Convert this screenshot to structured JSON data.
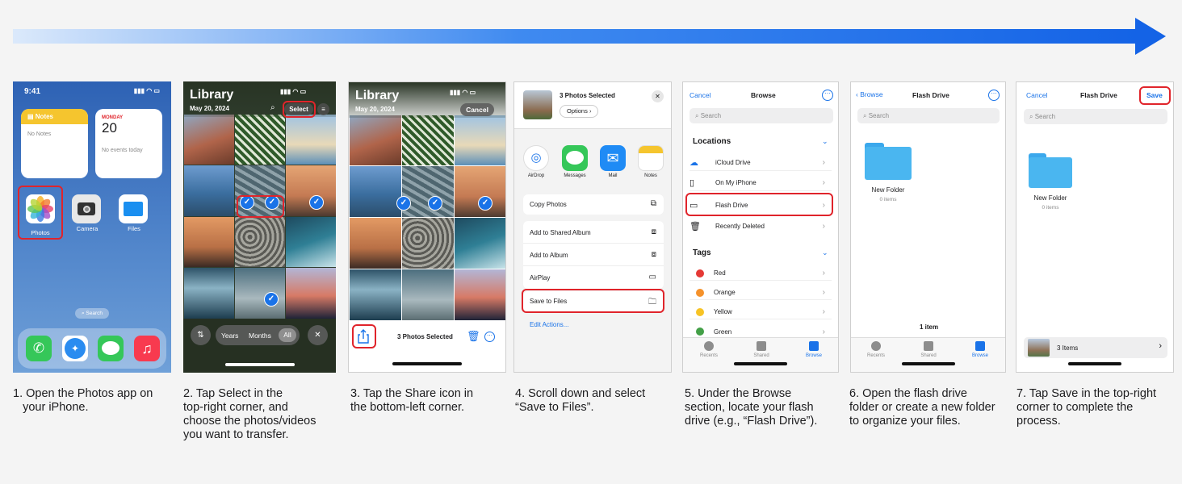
{
  "captions": [
    "1. Open the Photos app on\n   your iPhone.",
    "2. Tap Select in the\ntop-right corner, and\nchoose the photos/videos\nyou want to transfer.",
    "3. Tap the Share icon in\nthe bottom-left corner.",
    "4. Scroll down and select\n“Save to Files”.",
    "5. Under the Browse\nsection, locate your flash\ndrive (e.g., “Flash Drive”).",
    "6. Open the flash drive\nfolder or create a new folder\nto organize your files.",
    "7. Tap Save in the top-right\ncorner to complete the\nprocess."
  ],
  "colors": {
    "accent": "#1a73e8",
    "highlight": "#e0242b"
  },
  "s1": {
    "time": "9:41",
    "notes_title": "Notes",
    "notes_body": "No Notes",
    "cal_day": "MONDAY",
    "cal_date": "20",
    "cal_body": "No events today",
    "apps": [
      "Photos",
      "Camera",
      "Files"
    ],
    "search": "Search"
  },
  "s2": {
    "title": "Library",
    "date": "May 20, 2024",
    "select": "Select",
    "seg": [
      "Years",
      "Months",
      "All"
    ]
  },
  "s3": {
    "title": "Library",
    "date": "May 20, 2024",
    "cancel": "Cancel",
    "selected": "3 Photos Selected"
  },
  "s4": {
    "header": "3 Photos Selected",
    "options": "Options",
    "apps": [
      "AirDrop",
      "Messages",
      "Mail",
      "Notes"
    ],
    "actions": [
      "Copy Photos",
      "Add to Shared Album",
      "Add to Album",
      "AirPlay",
      "Save to Files"
    ],
    "edit": "Edit Actions..."
  },
  "s5": {
    "cancel": "Cancel",
    "title": "Browse",
    "search": "Search",
    "locations": "Locations",
    "locs": [
      "iCloud Drive",
      "On My iPhone",
      "Flash Drive",
      "Recently Deleted"
    ],
    "tags": "Tags",
    "tag_list": [
      "Red",
      "Orange",
      "Yellow",
      "Green"
    ],
    "tabs": [
      "Recents",
      "Shared",
      "Browse"
    ]
  },
  "s6": {
    "back": "Browse",
    "title": "Flash Drive",
    "search": "Search",
    "folder": "New Folder",
    "folder_sub": "0 items",
    "count": "1 item",
    "tabs": [
      "Recents",
      "Shared",
      "Browse"
    ]
  },
  "s7": {
    "cancel": "Cancel",
    "title": "Flash Drive",
    "save": "Save",
    "search": "Search",
    "folder": "New Folder",
    "folder_sub": "0 items",
    "items": "3 Items"
  }
}
